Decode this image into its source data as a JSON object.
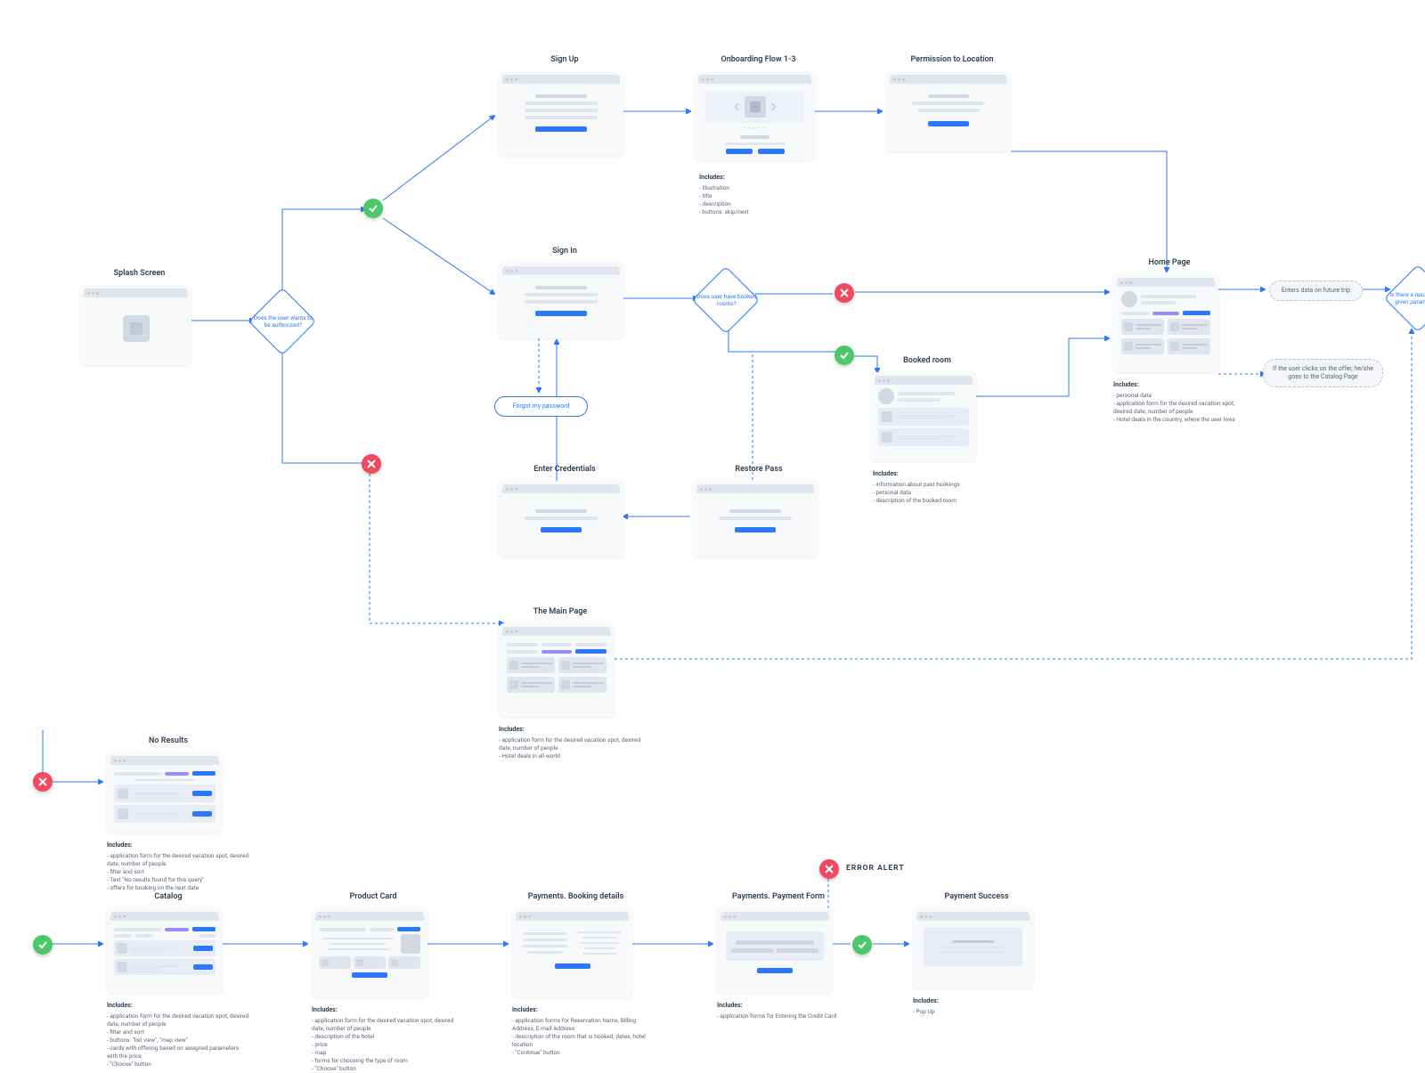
{
  "titles": {
    "splash": "Splash Screen",
    "signup": "Sign Up",
    "onboarding": "Onboarding Flow 1-3",
    "permission": "Permission to Location",
    "signin": "Sign In",
    "forgot": "Forgot my password",
    "enter_cred": "Enter Credentials",
    "restore": "Restore Pass",
    "booked": "Booked room",
    "home": "Home Page",
    "main": "The Main Page",
    "noresults": "No Results",
    "catalog": "Catalog",
    "product": "Product Card",
    "pay_details": "Payments. Booking details",
    "pay_form": "Payments. Payment Form",
    "pay_success": "Payment Success",
    "error_alert": "ERROR ALERT"
  },
  "decisions": {
    "authorize": "Does the user wants to be authorized?",
    "has_booked": "Does user have booked rooms?",
    "results": "Is there a result for the given parameters?"
  },
  "chips": {
    "enters_data": "Enters data on future trip",
    "clicks_offer": "If the user clicks on the offer, he/she goes to the Catalog Page"
  },
  "includes_label": "Includes:",
  "includes": {
    "onboarding": [
      "illustration",
      "title",
      "description",
      "buttons: skip/next"
    ],
    "booked": [
      "information about past bookings",
      "personal data",
      "description of the booked room"
    ],
    "home": [
      "personal data",
      "application form for the desired vacation spot, desired date, number of people",
      "Hotel deals in the country, where the user lives"
    ],
    "main": [
      "application form for the desired vacation spot, desired date, number of people",
      "Hotel deals in all world"
    ],
    "noresults": [
      "application form for the desired vacation spot, desired date, number of people",
      "filter and sort",
      "Text \"No results found for this query\"",
      "offers for booking on the next date"
    ],
    "catalog": [
      "application form for the desired vacation spot, desired date, number of people",
      "filter and sort",
      "buttons: \"list view\", \"map view\"",
      "cards with offering based on assigned parameters with the price",
      "\"Choose\" button"
    ],
    "product": [
      "application form for the desired vacation spot, desired date, number of people",
      "description of the hotel",
      "price",
      "map",
      "forms for choosing the type of room",
      "\"Choose\" button"
    ],
    "pay_details": [
      "application forms for Reservation Name, Billing Address, E-mail Address",
      "description of the room that is booked, dates, hotel location",
      "\"Continue\" button"
    ],
    "pay_form": [
      "application forms for Entering the Credit Card"
    ],
    "pay_success": [
      "Pop Up"
    ]
  }
}
